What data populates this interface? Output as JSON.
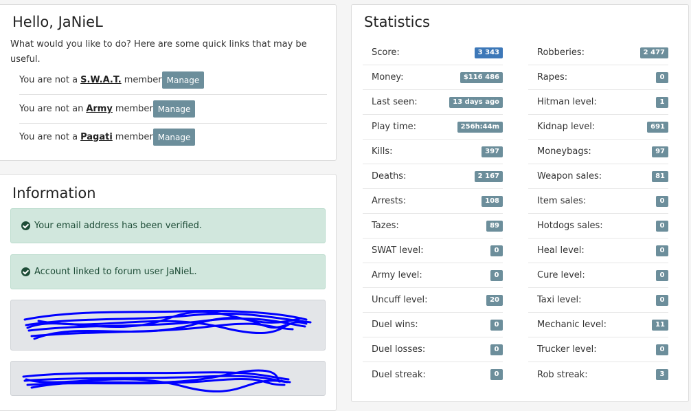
{
  "hello": {
    "title": "Hello, JaNieL",
    "intro": "What would you like to do? Here are some quick links that may be useful.",
    "links": [
      {
        "prefix": "You are not a",
        "group": "S.W.A.T.",
        "suffix": "member",
        "button": "Manage"
      },
      {
        "prefix": "You are not an",
        "group": "Army",
        "suffix": "member",
        "button": "Manage"
      },
      {
        "prefix": "You are not a",
        "group": "Pagati",
        "suffix": "member",
        "button": "Manage"
      }
    ]
  },
  "information": {
    "title": "Information",
    "alerts": [
      "Your email address has been verified.",
      "Account linked to forum user JaNieL."
    ]
  },
  "statistics": {
    "title": "Statistics",
    "left": [
      {
        "label": "Score:",
        "value": "3 343"
      },
      {
        "label": "Money:",
        "value": "$116 486"
      },
      {
        "label": "Last seen:",
        "value": "13 days ago"
      },
      {
        "label": "Play time:",
        "value": "256h:44m"
      },
      {
        "label": "Kills:",
        "value": "397"
      },
      {
        "label": "Deaths:",
        "value": "2 167"
      },
      {
        "label": "Arrests:",
        "value": "108"
      },
      {
        "label": "Tazes:",
        "value": "89"
      },
      {
        "label": "SWAT level:",
        "value": "0"
      },
      {
        "label": "Army level:",
        "value": "0"
      },
      {
        "label": "Uncuff level:",
        "value": "20"
      },
      {
        "label": "Duel wins:",
        "value": "0"
      },
      {
        "label": "Duel losses:",
        "value": "0"
      },
      {
        "label": "Duel streak:",
        "value": "0"
      }
    ],
    "right": [
      {
        "label": "Robberies:",
        "value": "2 477"
      },
      {
        "label": "Rapes:",
        "value": "0"
      },
      {
        "label": "Hitman level:",
        "value": "1"
      },
      {
        "label": "Kidnap level:",
        "value": "691"
      },
      {
        "label": "Moneybags:",
        "value": "97"
      },
      {
        "label": "Weapon sales:",
        "value": "81"
      },
      {
        "label": "Item sales:",
        "value": "0"
      },
      {
        "label": "Hotdogs sales:",
        "value": "0"
      },
      {
        "label": "Heal level:",
        "value": "0"
      },
      {
        "label": "Cure level:",
        "value": "0"
      },
      {
        "label": "Taxi level:",
        "value": "0"
      },
      {
        "label": "Mechanic level:",
        "value": "11"
      },
      {
        "label": "Trucker level:",
        "value": "0"
      },
      {
        "label": "Rob streak:",
        "value": "3"
      }
    ]
  },
  "colors": {
    "badge": "#6c8e9b",
    "badge_primary": "#3d78b8",
    "alert_success_bg": "#d1e7dd",
    "scribble": "#0000ff"
  }
}
